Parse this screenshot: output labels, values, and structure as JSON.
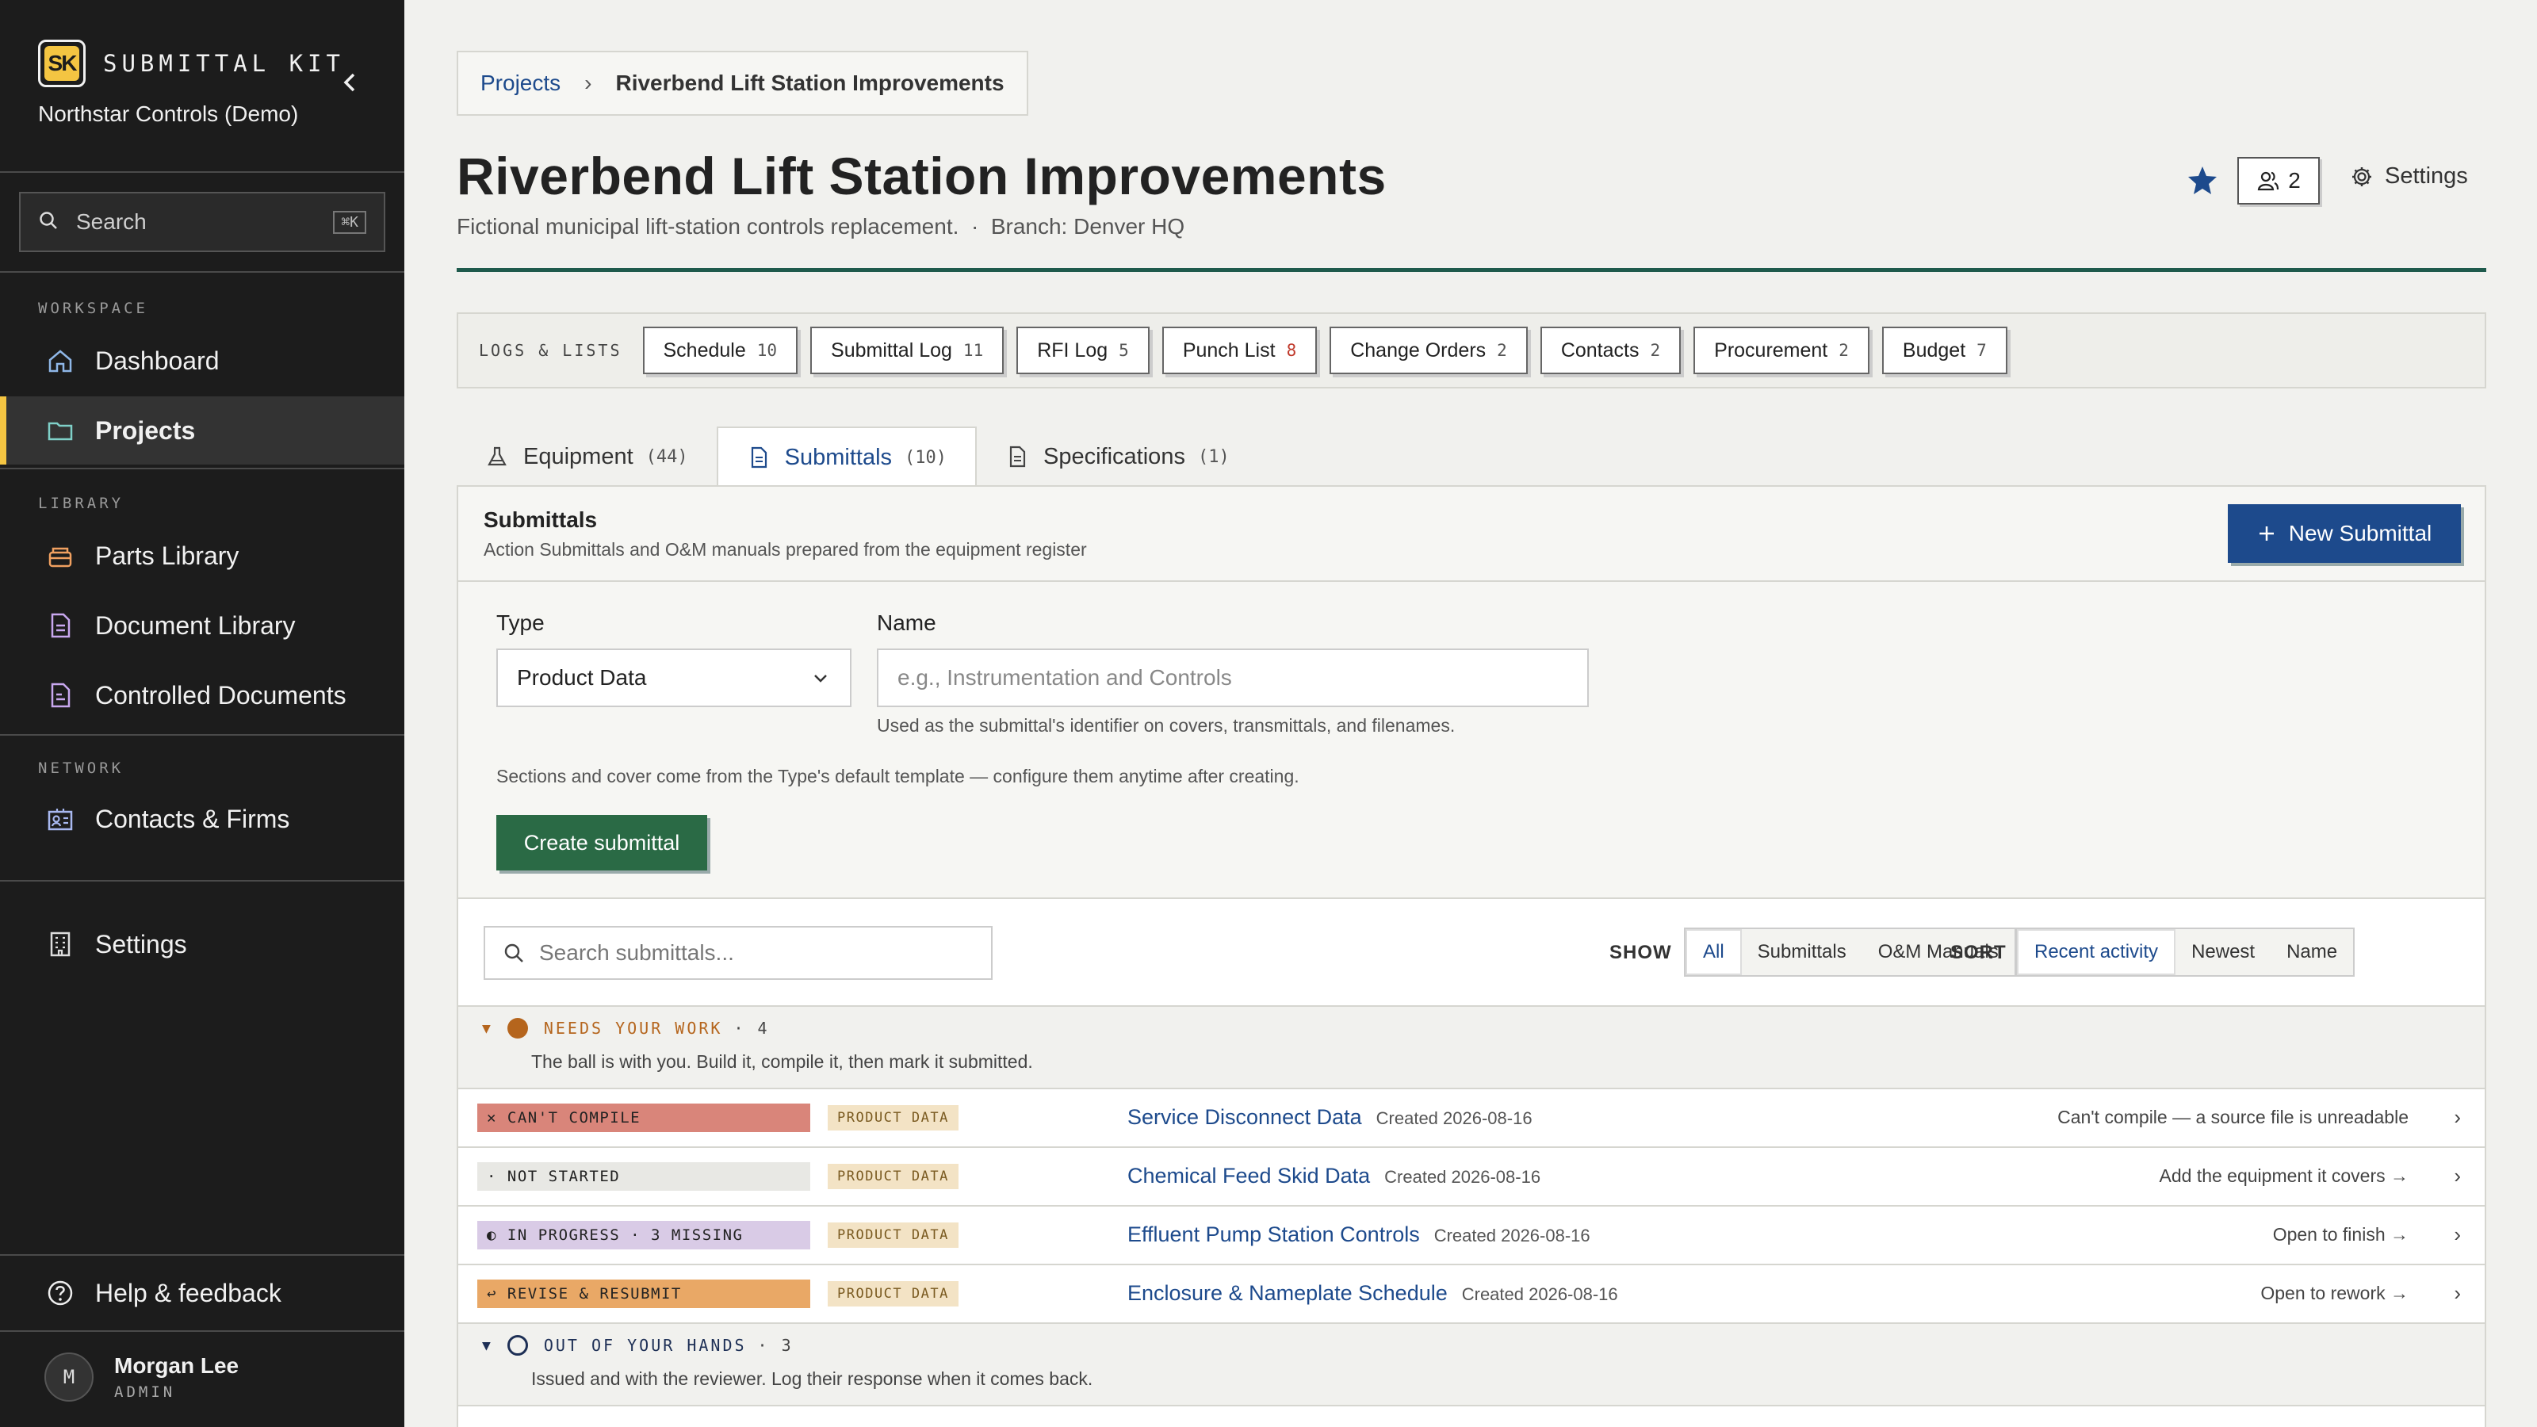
{
  "app": {
    "logo_text": "SK",
    "name": "SUBMITTAL KIT",
    "org": "Northstar Controls (Demo)"
  },
  "sidebar": {
    "search_placeholder": "Search",
    "search_shortcut": "⌘K",
    "sections": {
      "workspace": "WORKSPACE",
      "library": "LIBRARY",
      "network": "NETWORK"
    },
    "items": [
      {
        "label": "Dashboard",
        "icon": "home-icon"
      },
      {
        "label": "Projects",
        "icon": "folder-icon",
        "active": true
      },
      {
        "label": "Parts Library",
        "icon": "box-icon"
      },
      {
        "label": "Document Library",
        "icon": "document-icon"
      },
      {
        "label": "Controlled Documents",
        "icon": "controlled-document-icon"
      },
      {
        "label": "Contacts & Firms",
        "icon": "contacts-icon"
      },
      {
        "label": "Settings",
        "icon": "building-icon"
      }
    ],
    "help": "Help & feedback",
    "user": {
      "initial": "M",
      "name": "Morgan Lee",
      "role": "ADMIN"
    }
  },
  "breadcrumb": {
    "root": "Projects",
    "current": "Riverbend Lift Station Improvements"
  },
  "project": {
    "title": "Riverbend Lift Station Improvements",
    "description": "Fictional municipal lift-station controls replacement.",
    "branch": "Branch: Denver HQ",
    "members_count": "2",
    "settings_label": "Settings"
  },
  "logs": {
    "label": "LOGS & LISTS",
    "items": [
      {
        "label": "Schedule",
        "count": "10"
      },
      {
        "label": "Submittal Log",
        "count": "11"
      },
      {
        "label": "RFI Log",
        "count": "5"
      },
      {
        "label": "Punch List",
        "count": "8",
        "alert": true
      },
      {
        "label": "Change Orders",
        "count": "2"
      },
      {
        "label": "Contacts",
        "count": "2"
      },
      {
        "label": "Procurement",
        "count": "2"
      },
      {
        "label": "Budget",
        "count": "7"
      }
    ]
  },
  "tabs": [
    {
      "label": "Equipment",
      "count": "(44)"
    },
    {
      "label": "Submittals",
      "count": "(10)",
      "active": true
    },
    {
      "label": "Specifications",
      "count": "(1)"
    }
  ],
  "panel": {
    "title": "Submittals",
    "description": "Action Submittals and O&M manuals prepared from the equipment register",
    "new_button": "New Submittal"
  },
  "form": {
    "type_label": "Type",
    "type_value": "Product Data",
    "name_label": "Name",
    "name_placeholder": "e.g., Instrumentation and Controls",
    "name_help": "Used as the submittal's identifier on covers, transmittals, and filenames.",
    "template_note": "Sections and cover come from the Type's default template — configure them anytime after creating.",
    "create_button": "Create submittal"
  },
  "list": {
    "search_placeholder": "Search submittals...",
    "show_label": "SHOW",
    "show_options": [
      "All",
      "Submittals",
      "O&M Manuals"
    ],
    "sort_label": "SORT",
    "sort_options": [
      "Recent activity",
      "Newest",
      "Name"
    ],
    "groups": [
      {
        "title": "NEEDS YOUR WORK",
        "count": "· 4",
        "subtitle": "The ball is with you. Build it, compile it, then mark it submitted.",
        "color": "#b5651d"
      },
      {
        "title": "OUT OF YOUR HANDS",
        "count": "· 3",
        "subtitle": "Issued and with the reviewer. Log their response when it comes back.",
        "color": "#1d2f55"
      }
    ],
    "rows": [
      {
        "status": "✕ CAN'T COMPILE",
        "status_color": "#d9857a",
        "type": "PRODUCT DATA",
        "name": "Service Disconnect Data",
        "created": "Created 2026-08-16",
        "action": "Can't compile — a source file is unreadable"
      },
      {
        "status": "· NOT STARTED",
        "status_color": "#e8e8e4",
        "type": "PRODUCT DATA",
        "name": "Chemical Feed Skid Data",
        "created": "Created 2026-08-16",
        "action": "Add the equipment it covers →"
      },
      {
        "status": "◐ IN PROGRESS · 3 MISSING",
        "status_color": "#d9cbe6",
        "type": "PRODUCT DATA",
        "name": "Effluent Pump Station Controls",
        "created": "Created 2026-08-16",
        "action": "Open to finish →"
      },
      {
        "status": "↩ REVISE & RESUBMIT",
        "status_color": "#e9a866",
        "type": "PRODUCT DATA",
        "name": "Enclosure & Nameplate Schedule",
        "created": "Created 2026-08-16",
        "action": "Open to rework →"
      }
    ]
  }
}
